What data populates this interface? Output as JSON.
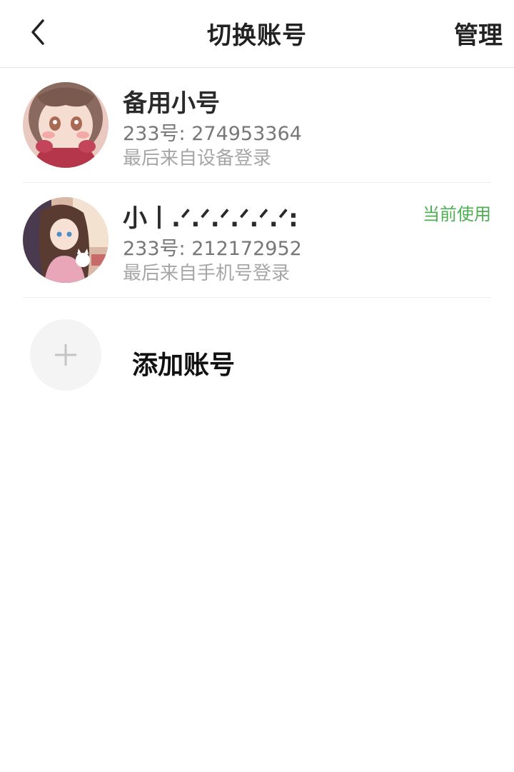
{
  "header": {
    "title": "切换账号",
    "manage_label": "管理"
  },
  "accounts": [
    {
      "name": "备用小号",
      "id_text": "233号: 274953364",
      "login_text": "最后来自设备登录",
      "current_label": ""
    },
    {
      "name": "小丨.ᐟ.ᐟ.ᐟ.ᐟ.ᐟ.ᐟ:",
      "id_text": "233号: 212172952",
      "login_text": "最后来自手机号登录",
      "current_label": "当前使用"
    }
  ],
  "add_account": {
    "label": "添加账号"
  },
  "icons": {
    "back": "chevron-left-icon",
    "add": "plus-icon"
  },
  "colors": {
    "current_badge": "#4caf50",
    "secondary_text": "#777777",
    "tertiary_text": "#a6a6a6",
    "divider": "#ececec"
  }
}
